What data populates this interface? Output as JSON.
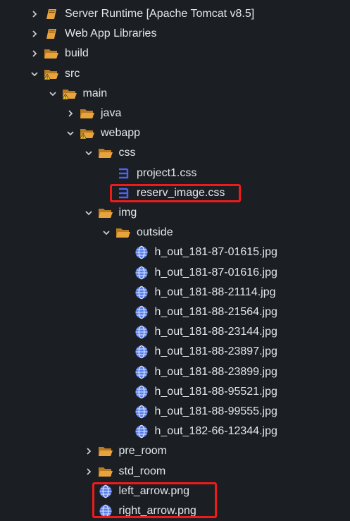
{
  "tree": [
    {
      "label": "Server Runtime [Apache Tomcat v8.5]",
      "depth": 0,
      "expander": "collapsed",
      "icon": "library-book-icon"
    },
    {
      "label": "Web App Libraries",
      "depth": 0,
      "expander": "collapsed",
      "icon": "library-book-icon"
    },
    {
      "label": "build",
      "depth": 0,
      "expander": "collapsed",
      "icon": "folder-icon"
    },
    {
      "label": "src",
      "depth": 0,
      "expander": "expanded",
      "icon": "folder-warning-icon"
    },
    {
      "label": "main",
      "depth": 1,
      "expander": "expanded",
      "icon": "folder-warning-icon"
    },
    {
      "label": "java",
      "depth": 2,
      "expander": "collapsed",
      "icon": "folder-icon"
    },
    {
      "label": "webapp",
      "depth": 2,
      "expander": "expanded",
      "icon": "folder-warning-icon"
    },
    {
      "label": "css",
      "depth": 3,
      "expander": "expanded",
      "icon": "folder-icon"
    },
    {
      "label": "project1.css",
      "depth": 4,
      "expander": "none",
      "icon": "css-file-icon"
    },
    {
      "label": "reserv_image.css",
      "depth": 4,
      "expander": "none",
      "icon": "css-file-icon",
      "highlighted": true
    },
    {
      "label": "img",
      "depth": 3,
      "expander": "expanded",
      "icon": "folder-icon"
    },
    {
      "label": "outside",
      "depth": 4,
      "expander": "expanded",
      "icon": "folder-icon"
    },
    {
      "label": "h_out_181-87-01615.jpg",
      "depth": 5,
      "expander": "none",
      "icon": "image-file-icon"
    },
    {
      "label": "h_out_181-87-01616.jpg",
      "depth": 5,
      "expander": "none",
      "icon": "image-file-icon"
    },
    {
      "label": "h_out_181-88-21114.jpg",
      "depth": 5,
      "expander": "none",
      "icon": "image-file-icon"
    },
    {
      "label": "h_out_181-88-21564.jpg",
      "depth": 5,
      "expander": "none",
      "icon": "image-file-icon"
    },
    {
      "label": "h_out_181-88-23144.jpg",
      "depth": 5,
      "expander": "none",
      "icon": "image-file-icon"
    },
    {
      "label": "h_out_181-88-23897.jpg",
      "depth": 5,
      "expander": "none",
      "icon": "image-file-icon"
    },
    {
      "label": "h_out_181-88-23899.jpg",
      "depth": 5,
      "expander": "none",
      "icon": "image-file-icon"
    },
    {
      "label": "h_out_181-88-95521.jpg",
      "depth": 5,
      "expander": "none",
      "icon": "image-file-icon"
    },
    {
      "label": "h_out_181-88-99555.jpg",
      "depth": 5,
      "expander": "none",
      "icon": "image-file-icon"
    },
    {
      "label": "h_out_182-66-12344.jpg",
      "depth": 5,
      "expander": "none",
      "icon": "image-file-icon"
    },
    {
      "label": "pre_room",
      "depth": 3,
      "expander": "collapsed",
      "icon": "folder-icon"
    },
    {
      "label": "std_room",
      "depth": 3,
      "expander": "collapsed",
      "icon": "folder-icon"
    },
    {
      "label": "left_arrow.png",
      "depth": 3,
      "expander": "none",
      "icon": "image-file-icon",
      "highlighted": true
    },
    {
      "label": "right_arrow.png",
      "depth": 3,
      "expander": "none",
      "icon": "image-file-icon",
      "highlighted": true
    }
  ],
  "colors": {
    "background": "#1b1e22",
    "text": "#e3e6ea",
    "folder": "#e8a33c",
    "warning": "#f2c230",
    "css_icon": "#4b63f0",
    "image_icon": "#5a7ee8",
    "highlight": "#ef1b1b"
  }
}
